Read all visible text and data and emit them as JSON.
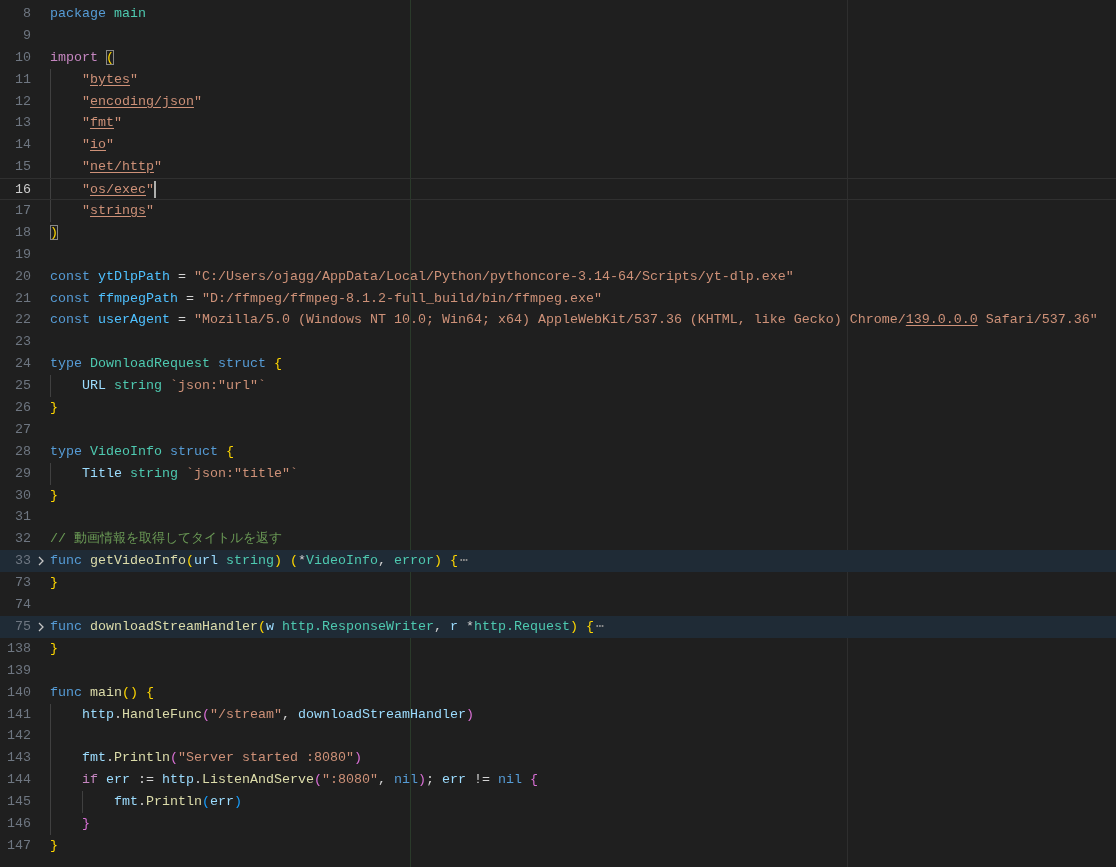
{
  "editor": {
    "lines": [
      {
        "number": "8",
        "current": false,
        "folded": false,
        "tokens": [
          {
            "kind": "kw",
            "text": "package "
          },
          {
            "kind": "type",
            "text": "main"
          }
        ]
      },
      {
        "number": "9",
        "current": false,
        "folded": false
      },
      {
        "number": "10",
        "current": false,
        "folded": false,
        "tokens": [
          {
            "kind": "ctl",
            "text": "import "
          },
          {
            "kind": "b1m",
            "text": "("
          }
        ]
      },
      {
        "number": "11",
        "current": false,
        "folded": false,
        "guides": [
          {
            "kind": "rule"
          }
        ],
        "tokens": [
          {
            "kind": "str",
            "text": "\""
          },
          {
            "kind": "link",
            "text": "bytes"
          },
          {
            "kind": "str",
            "text": "\""
          }
        ]
      },
      {
        "number": "12",
        "current": false,
        "folded": false,
        "guides": [
          {
            "kind": "rule"
          }
        ],
        "tokens": [
          {
            "kind": "str",
            "text": "\""
          },
          {
            "kind": "link",
            "text": "encoding/json"
          },
          {
            "kind": "str",
            "text": "\""
          }
        ]
      },
      {
        "number": "13",
        "current": false,
        "folded": false,
        "guides": [
          {
            "kind": "rule"
          }
        ],
        "tokens": [
          {
            "kind": "str",
            "text": "\""
          },
          {
            "kind": "link",
            "text": "fmt"
          },
          {
            "kind": "str",
            "text": "\""
          }
        ]
      },
      {
        "number": "14",
        "current": false,
        "folded": false,
        "guides": [
          {
            "kind": "rule"
          }
        ],
        "tokens": [
          {
            "kind": "str",
            "text": "\""
          },
          {
            "kind": "link",
            "text": "io"
          },
          {
            "kind": "str",
            "text": "\""
          }
        ]
      },
      {
        "number": "15",
        "current": false,
        "folded": false,
        "guides": [
          {
            "kind": "rule"
          }
        ],
        "tokens": [
          {
            "kind": "str",
            "text": "\""
          },
          {
            "kind": "link",
            "text": "net/http"
          },
          {
            "kind": "str",
            "text": "\""
          }
        ]
      },
      {
        "number": "16",
        "current": true,
        "folded": false,
        "guides": [
          {
            "kind": "rule"
          }
        ],
        "tokens": [
          {
            "kind": "str",
            "text": "\""
          },
          {
            "kind": "link",
            "text": "os/exec"
          },
          {
            "kind": "str",
            "text": "\""
          }
        ]
      },
      {
        "number": "17",
        "current": false,
        "folded": false,
        "guides": [
          {
            "kind": "rule"
          }
        ],
        "tokens": [
          {
            "kind": "str",
            "text": "\""
          },
          {
            "kind": "link",
            "text": "strings"
          },
          {
            "kind": "str",
            "text": "\""
          }
        ]
      },
      {
        "number": "18",
        "current": false,
        "folded": false,
        "tokens": [
          {
            "kind": "b1m",
            "text": ")"
          }
        ]
      },
      {
        "number": "19",
        "current": false,
        "folded": false
      },
      {
        "number": "20",
        "current": false,
        "folded": false,
        "tokens": [
          {
            "kind": "kw",
            "text": "const "
          },
          {
            "kind": "const",
            "text": "ytDlpPath"
          },
          {
            "kind": "txt",
            "text": " = "
          },
          {
            "kind": "str",
            "text": "\"C:/Users/ojagg/AppData/Local/Python/pythoncore-3.14-64/Scripts/yt-dlp.exe\""
          }
        ]
      },
      {
        "number": "21",
        "current": false,
        "folded": false,
        "tokens": [
          {
            "kind": "kw",
            "text": "const "
          },
          {
            "kind": "const",
            "text": "ffmpegPath"
          },
          {
            "kind": "txt",
            "text": " = "
          },
          {
            "kind": "str",
            "text": "\"D:/ffmpeg/ffmpeg-8.1.2-full_build/bin/ffmpeg.exe\""
          }
        ]
      },
      {
        "number": "22",
        "current": false,
        "folded": false,
        "tokens": [
          {
            "kind": "kw",
            "text": "const "
          },
          {
            "kind": "const",
            "text": "userAgent"
          },
          {
            "kind": "txt",
            "text": " = "
          },
          {
            "kind": "str",
            "text": "\"Mozilla/5.0 (Windows NT 10.0; Win64; x64) AppleWebKit/537.36 (KHTML, like Gecko) Chrome/"
          },
          {
            "kind": "link",
            "text": "139.0.0.0"
          },
          {
            "kind": "str",
            "text": " Safari/537.36\""
          }
        ]
      },
      {
        "number": "23",
        "current": false,
        "folded": false
      },
      {
        "number": "24",
        "current": false,
        "folded": false,
        "tokens": [
          {
            "kind": "kw",
            "text": "type "
          },
          {
            "kind": "type",
            "text": "DownloadRequest "
          },
          {
            "kind": "kw",
            "text": "struct "
          },
          {
            "kind": "b1",
            "text": "{"
          }
        ]
      },
      {
        "number": "25",
        "current": false,
        "folded": false,
        "guides": [
          {
            "kind": "rule"
          }
        ],
        "tokens": [
          {
            "kind": "var",
            "text": "URL "
          },
          {
            "kind": "type",
            "text": "string "
          },
          {
            "kind": "str",
            "text": "`json:\"url\"`"
          }
        ]
      },
      {
        "number": "26",
        "current": false,
        "folded": false,
        "tokens": [
          {
            "kind": "b1",
            "text": "}"
          }
        ]
      },
      {
        "number": "27",
        "current": false,
        "folded": false
      },
      {
        "number": "28",
        "current": false,
        "folded": false,
        "tokens": [
          {
            "kind": "kw",
            "text": "type "
          },
          {
            "kind": "type",
            "text": "VideoInfo "
          },
          {
            "kind": "kw",
            "text": "struct "
          },
          {
            "kind": "b1",
            "text": "{"
          }
        ]
      },
      {
        "number": "29",
        "current": false,
        "folded": false,
        "guides": [
          {
            "kind": "rule"
          }
        ],
        "tokens": [
          {
            "kind": "var",
            "text": "Title "
          },
          {
            "kind": "type",
            "text": "string "
          },
          {
            "kind": "str",
            "text": "`json:\"title\"`"
          }
        ]
      },
      {
        "number": "30",
        "current": false,
        "folded": false,
        "tokens": [
          {
            "kind": "b1",
            "text": "}"
          }
        ]
      },
      {
        "number": "31",
        "current": false,
        "folded": false
      },
      {
        "number": "32",
        "current": false,
        "folded": false,
        "tokens": [
          {
            "kind": "cmt",
            "text": "// 動画情報を取得してタイトルを返す"
          }
        ]
      },
      {
        "number": "33",
        "current": false,
        "folded": true,
        "tokens": [
          {
            "kind": "kw",
            "text": "func "
          },
          {
            "kind": "fn",
            "text": "getVideoInfo"
          },
          {
            "kind": "b1",
            "text": "("
          },
          {
            "kind": "var",
            "text": "url "
          },
          {
            "kind": "type",
            "text": "string"
          },
          {
            "kind": "b1",
            "text": ") ("
          },
          {
            "kind": "txt",
            "text": "*"
          },
          {
            "kind": "type",
            "text": "VideoInfo"
          },
          {
            "kind": "txt",
            "text": ", "
          },
          {
            "kind": "type",
            "text": "error"
          },
          {
            "kind": "b1",
            "text": ") {"
          },
          {
            "kind": "fold",
            "text": "⋯"
          }
        ]
      },
      {
        "number": "73",
        "current": false,
        "folded": false,
        "tokens": [
          {
            "kind": "b1",
            "text": "}"
          }
        ]
      },
      {
        "number": "74",
        "current": false,
        "folded": false
      },
      {
        "number": "75",
        "current": false,
        "folded": true,
        "tokens": [
          {
            "kind": "kw",
            "text": "func "
          },
          {
            "kind": "fn",
            "text": "downloadStreamHandler"
          },
          {
            "kind": "b1",
            "text": "("
          },
          {
            "kind": "var",
            "text": "w "
          },
          {
            "kind": "type",
            "text": "http.ResponseWriter"
          },
          {
            "kind": "txt",
            "text": ", "
          },
          {
            "kind": "var",
            "text": "r"
          },
          {
            "kind": "txt",
            "text": " *"
          },
          {
            "kind": "type",
            "text": "http.Request"
          },
          {
            "kind": "b1",
            "text": ") {"
          },
          {
            "kind": "fold",
            "text": "⋯"
          }
        ]
      },
      {
        "number": "138",
        "current": false,
        "folded": false,
        "tokens": [
          {
            "kind": "b1",
            "text": "}"
          }
        ]
      },
      {
        "number": "139",
        "current": false,
        "folded": false
      },
      {
        "number": "140",
        "current": false,
        "folded": false,
        "tokens": [
          {
            "kind": "kw",
            "text": "func "
          },
          {
            "kind": "fn",
            "text": "main"
          },
          {
            "kind": "b1",
            "text": "() {"
          }
        ]
      },
      {
        "number": "141",
        "current": false,
        "folded": false,
        "guides": [
          {
            "kind": "rule"
          }
        ],
        "tokens": [
          {
            "kind": "var",
            "text": "http"
          },
          {
            "kind": "txt",
            "text": "."
          },
          {
            "kind": "fn",
            "text": "HandleFunc"
          },
          {
            "kind": "b2",
            "text": "("
          },
          {
            "kind": "str",
            "text": "\"/stream\""
          },
          {
            "kind": "txt",
            "text": ", "
          },
          {
            "kind": "var",
            "text": "downloadStreamHandler"
          },
          {
            "kind": "b2",
            "text": ")"
          }
        ]
      },
      {
        "number": "142",
        "current": false,
        "folded": false,
        "guides": [
          {
            "kind": "rule"
          }
        ]
      },
      {
        "number": "143",
        "current": false,
        "folded": false,
        "guides": [
          {
            "kind": "rule"
          }
        ],
        "tokens": [
          {
            "kind": "var",
            "text": "fmt"
          },
          {
            "kind": "txt",
            "text": "."
          },
          {
            "kind": "fn",
            "text": "Println"
          },
          {
            "kind": "b2",
            "text": "("
          },
          {
            "kind": "str",
            "text": "\"Server started :8080\""
          },
          {
            "kind": "b2",
            "text": ")"
          }
        ]
      },
      {
        "number": "144",
        "current": false,
        "folded": false,
        "guides": [
          {
            "kind": "rule"
          }
        ],
        "tokens": [
          {
            "kind": "ctl",
            "text": "if "
          },
          {
            "kind": "var",
            "text": "err"
          },
          {
            "kind": "txt",
            "text": " := "
          },
          {
            "kind": "var",
            "text": "http"
          },
          {
            "kind": "txt",
            "text": "."
          },
          {
            "kind": "fn",
            "text": "ListenAndServe"
          },
          {
            "kind": "b2",
            "text": "("
          },
          {
            "kind": "str",
            "text": "\":8080\""
          },
          {
            "kind": "txt",
            "text": ", "
          },
          {
            "kind": "kw",
            "text": "nil"
          },
          {
            "kind": "b2",
            "text": ")"
          },
          {
            "kind": "txt",
            "text": "; "
          },
          {
            "kind": "var",
            "text": "err"
          },
          {
            "kind": "txt",
            "text": " != "
          },
          {
            "kind": "kw",
            "text": "nil "
          },
          {
            "kind": "b2",
            "text": "{"
          }
        ]
      },
      {
        "number": "145",
        "current": false,
        "folded": false,
        "guides": [
          {
            "kind": "rule"
          },
          {
            "kind": "rule"
          }
        ],
        "tokens": [
          {
            "kind": "var",
            "text": "fmt"
          },
          {
            "kind": "txt",
            "text": "."
          },
          {
            "kind": "fn",
            "text": "Println"
          },
          {
            "kind": "b3",
            "text": "("
          },
          {
            "kind": "var",
            "text": "err"
          },
          {
            "kind": "b3",
            "text": ")"
          }
        ]
      },
      {
        "number": "146",
        "current": false,
        "folded": false,
        "guides": [
          {
            "kind": "rule"
          }
        ],
        "tokens": [
          {
            "kind": "b2",
            "text": "}"
          }
        ]
      },
      {
        "number": "147",
        "current": false,
        "folded": false,
        "tokens": [
          {
            "kind": "b1",
            "text": "}"
          }
        ]
      }
    ]
  }
}
